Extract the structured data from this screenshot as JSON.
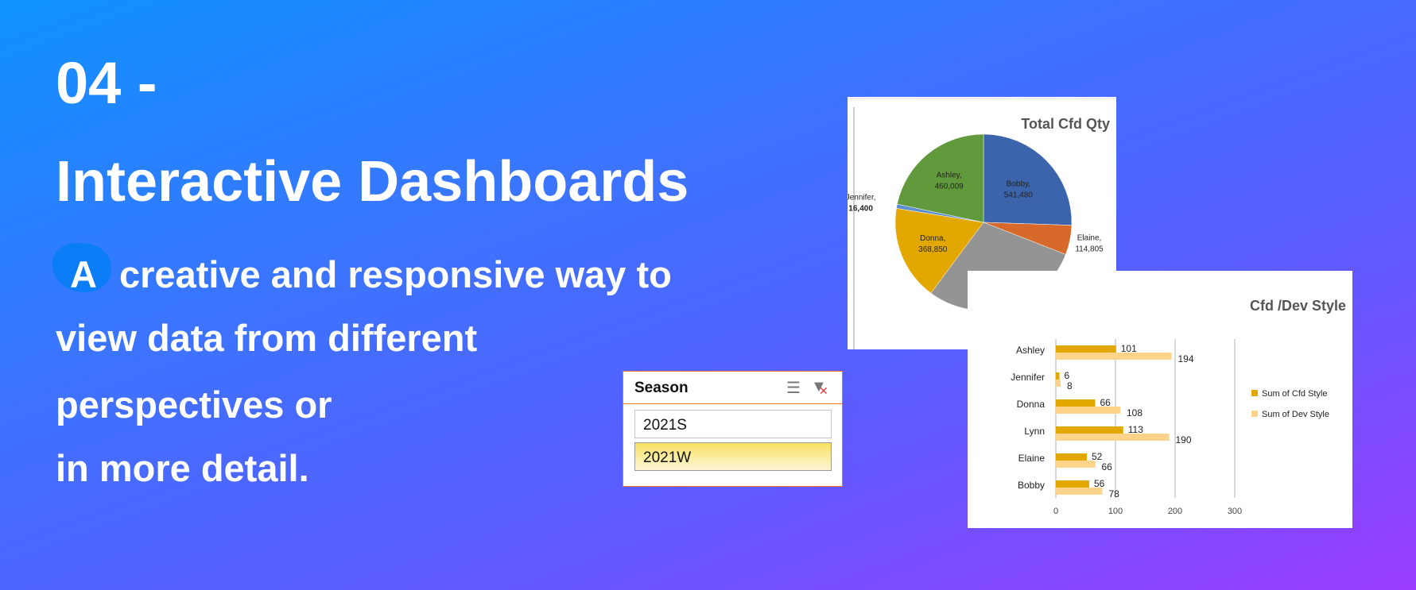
{
  "headline": {
    "line1": "04 -",
    "line2": "Interactive Dashboards"
  },
  "body": {
    "first_letter": "A",
    "line1_rest": "creative and responsive way to",
    "line2": "view data from different",
    "line3": "perspectives or",
    "line4": "in more detail."
  },
  "slicer": {
    "title": "Season",
    "multiselect_icon": "multi-select-icon",
    "clear_icon": "clear-filter-icon",
    "items": [
      {
        "label": "2021S",
        "selected": false
      },
      {
        "label": "2021W",
        "selected": true
      }
    ]
  },
  "chart_data": [
    {
      "type": "pie",
      "title": "Total Cfd Qty",
      "slices": [
        {
          "name": "Bobby",
          "value": 541480,
          "label": "Bobby,",
          "value_label": "541,480",
          "color": "#3c64ad"
        },
        {
          "name": "Elaine",
          "value": 114805,
          "label": "Elaine,",
          "value_label": "114,805",
          "color": "#d7692a"
        },
        {
          "name": "Lynn",
          "value": 620000,
          "label": "",
          "value_label": "",
          "color": "#949494"
        },
        {
          "name": "Donna",
          "value": 368850,
          "label": "Donna,",
          "value_label": "368,850",
          "color": "#e2a800"
        },
        {
          "name": "Jennifer",
          "value": 16400,
          "label": "Jennifer,",
          "value_label": "16,400",
          "color": "#5b8fd0"
        },
        {
          "name": "Ashley",
          "value": 460009,
          "label": "Ashley,",
          "value_label": "460,009",
          "color": "#619a3c"
        }
      ]
    },
    {
      "type": "bar",
      "title": "Cfd /Dev Style",
      "orientation": "horizontal",
      "categories": [
        "Ashley",
        "Jennifer",
        "Donna",
        "Lynn",
        "Elaine",
        "Bobby"
      ],
      "series": [
        {
          "name": "Sum of Cfd Style",
          "values": [
            101,
            6,
            66,
            113,
            52,
            56
          ],
          "color": "#e2a800"
        },
        {
          "name": "Sum of Dev Style",
          "values": [
            194,
            8,
            108,
            190,
            66,
            78
          ],
          "color": "#ffd38a"
        }
      ],
      "xlim": [
        0,
        300
      ],
      "xticks": [
        "0",
        "100",
        "200",
        "300"
      ],
      "legend": "right"
    }
  ]
}
